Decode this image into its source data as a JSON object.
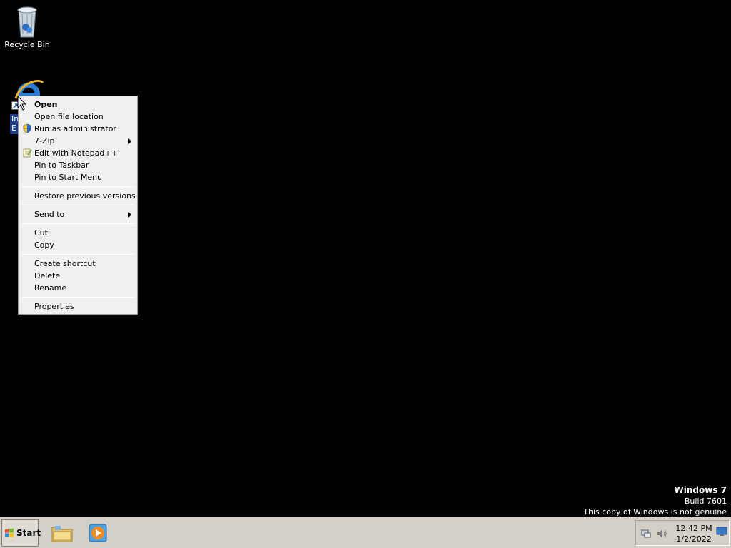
{
  "desktop": {
    "icons": [
      {
        "label": "Recycle Bin",
        "icon": "recycle-bin-icon"
      },
      {
        "label": "In\nE",
        "icon": "internet-explorer-icon"
      }
    ]
  },
  "context_menu": {
    "items": [
      {
        "label": "Open",
        "bold": true
      },
      {
        "label": "Open file location"
      },
      {
        "label": "Run as administrator",
        "icon": "uac-shield-icon"
      },
      {
        "label": "7-Zip",
        "submenu": true
      },
      {
        "label": "Edit with Notepad++",
        "icon": "notepadpp-icon"
      },
      {
        "label": "Pin to Taskbar"
      },
      {
        "label": "Pin to Start Menu"
      },
      {
        "label": "Restore previous versions"
      },
      {
        "label": "Send to",
        "submenu": true
      },
      {
        "label": "Cut"
      },
      {
        "label": "Copy"
      },
      {
        "label": "Create shortcut"
      },
      {
        "label": "Delete"
      },
      {
        "label": "Rename"
      },
      {
        "label": "Properties"
      }
    ]
  },
  "watermark": {
    "line1": "Windows 7",
    "line2": "Build 7601",
    "line3": "This copy of Windows is not genuine"
  },
  "taskbar": {
    "start_label": "Start",
    "pinned": [
      "windows-explorer-icon",
      "media-player-icon"
    ],
    "clock_time": "12:42 PM",
    "clock_date": "1/2/2022",
    "tray_icons": [
      "network-icon",
      "volume-icon",
      "show-desktop-icon"
    ]
  },
  "colors": {
    "desktop_bg": "#000000",
    "taskbar_bg": "#d4d0c8",
    "menu_bg": "#f0f0f0"
  }
}
